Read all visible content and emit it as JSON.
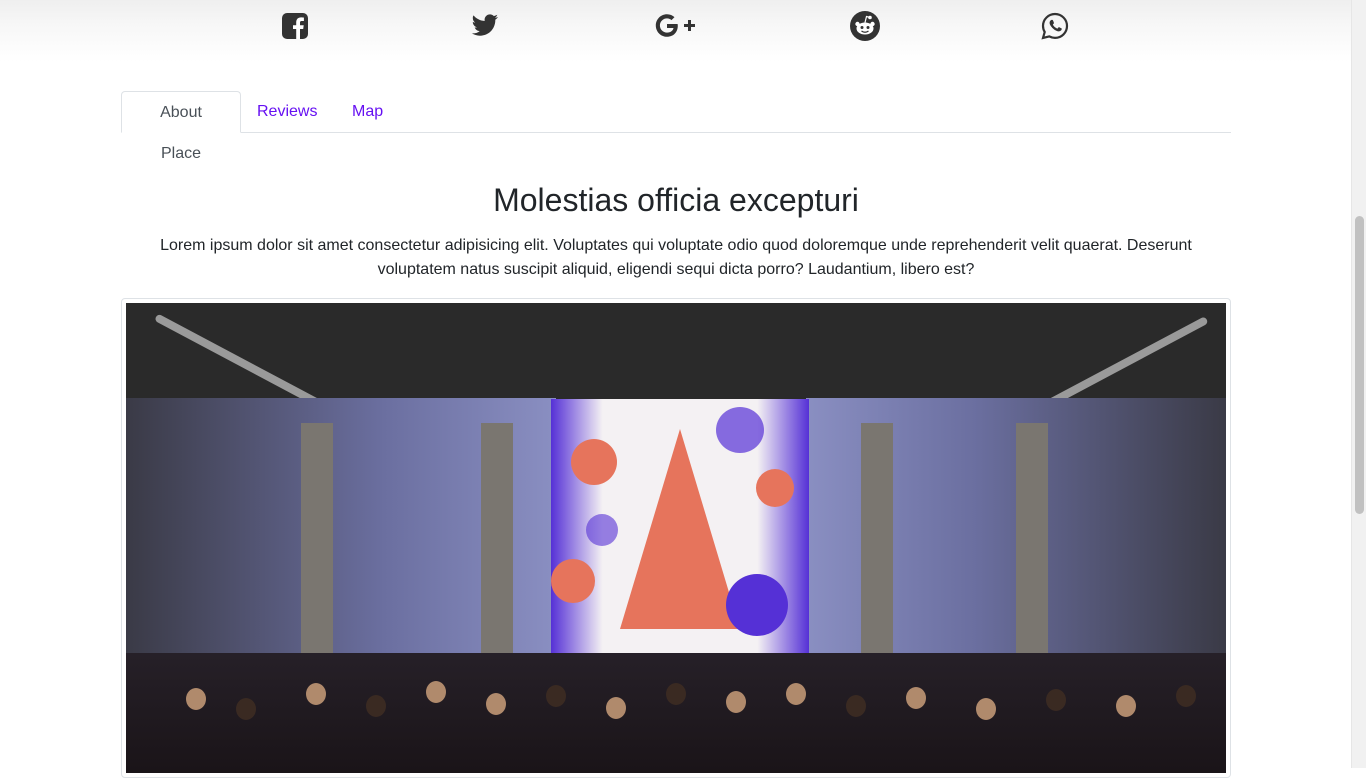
{
  "share": {
    "items": [
      {
        "name": "facebook",
        "icon": "facebook-square-icon"
      },
      {
        "name": "twitter",
        "icon": "twitter-icon"
      },
      {
        "name": "google-plus",
        "icon": "google-plus-icon"
      },
      {
        "name": "reddit",
        "icon": "reddit-icon"
      },
      {
        "name": "whatsapp",
        "icon": "whatsapp-icon"
      }
    ],
    "icon_color": "#333333"
  },
  "tabs": [
    {
      "label": "About Place",
      "active": true
    },
    {
      "label": "Reviews",
      "active": false
    },
    {
      "label": "Map",
      "active": false
    }
  ],
  "content": {
    "title": "Molestias officia excepturi",
    "description": "Lorem ipsum dolor sit amet consectetur adipisicing elit. Voluptates qui voluptate odio quod doloremque unde reprehenderit velit quaerat. Deserunt voluptatem natus suscipit aliquid, eligendi sequi dicta porro? Laudantium, libero est?"
  },
  "colors": {
    "link": "#6610f2",
    "text": "#212529",
    "tab_active_text": "#495057",
    "border": "#dee2e6"
  }
}
